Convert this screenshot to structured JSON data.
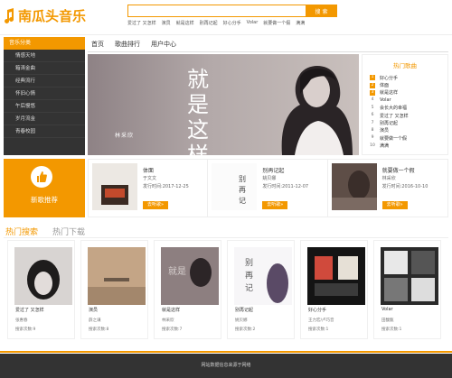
{
  "brand": {
    "name": "南瓜头音乐",
    "accent": "#f39800"
  },
  "search": {
    "placeholder": "",
    "button": "搜 索"
  },
  "hotwords": [
    "爱过了 又怎样",
    "演员",
    "就是这样",
    "别再记起",
    "好心分手",
    "Volar",
    "就要做一个假",
    "满满"
  ],
  "sidebar": {
    "title": "音乐分类",
    "items": [
      "情感天地",
      "箱涛金曲",
      "经典流行",
      "怀旧心情",
      "午后慢悠",
      "岁月流金",
      "青春校园"
    ]
  },
  "nav": [
    "首页",
    "歌曲排行",
    "用户中心"
  ],
  "banner": {
    "title": "就是这样",
    "artist": "林采欣"
  },
  "hot_songs": {
    "title": "热门歌曲",
    "items": [
      {
        "num": "1",
        "name": "好心分手"
      },
      {
        "num": "2",
        "name": "体面"
      },
      {
        "num": "3",
        "name": "就是这样"
      },
      {
        "num": "4",
        "name": "Volar"
      },
      {
        "num": "5",
        "name": "会长大的幸福"
      },
      {
        "num": "6",
        "name": "爱过了 又怎样"
      },
      {
        "num": "7",
        "name": "别再记起"
      },
      {
        "num": "8",
        "name": "演员"
      },
      {
        "num": "9",
        "name": "就要做一个假"
      },
      {
        "num": "10",
        "name": "满满"
      }
    ]
  },
  "recommend": {
    "label": "新歌推荐",
    "cards": [
      {
        "title": "体面",
        "artist": "于文文",
        "date_label": "发行时间:",
        "date": "2017-12-25",
        "btn": "去听歌»"
      },
      {
        "title": "别再记起",
        "artist": "姚贝娜",
        "date_label": "发行时间:",
        "date": "2011-12-07",
        "btn": "去听歌»"
      },
      {
        "title": "就要做一个假",
        "artist": "林采欣",
        "date_label": "发行时间:",
        "date": "2016-10-10",
        "btn": "去听歌»"
      }
    ]
  },
  "tabs": [
    "热门搜索",
    "热门下载"
  ],
  "songs": [
    {
      "title": "爱过了 又怎样",
      "artist": "张惠春",
      "count_label": "搜索次数:",
      "count": "9"
    },
    {
      "title": "演员",
      "artist": "薛之谦",
      "count_label": "搜索次数:",
      "count": "8"
    },
    {
      "title": "就是这样",
      "artist": "林采欣",
      "count_label": "搜索次数:",
      "count": "7"
    },
    {
      "title": "别再记起",
      "artist": "姚贝娜",
      "count_label": "搜索次数:",
      "count": "2"
    },
    {
      "title": "好心分手",
      "artist": "王力宏/卢巧音",
      "count_label": "搜索次数:",
      "count": "1"
    },
    {
      "title": "Volar",
      "artist": "田馥甄",
      "count_label": "搜索次数:",
      "count": "1"
    }
  ],
  "footer": "网站数据信息来源于网络"
}
